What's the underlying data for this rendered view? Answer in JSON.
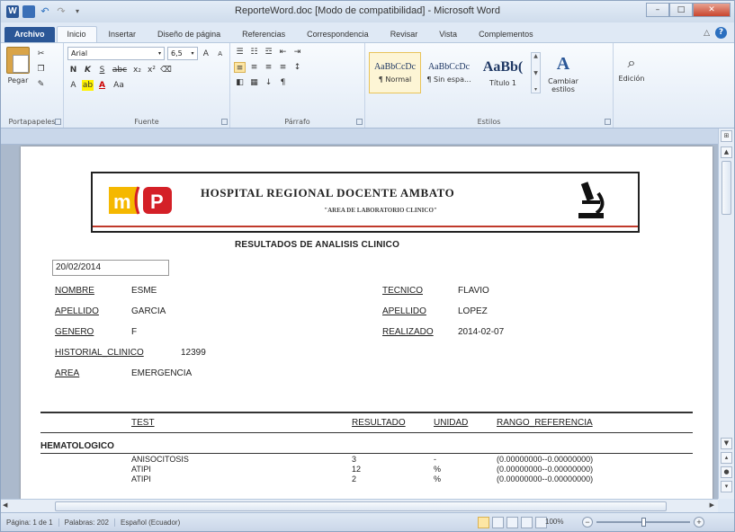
{
  "window": {
    "title": "ReporteWord.doc [Modo de compatibilidad] - Microsoft Word",
    "word_logo": "W",
    "min": "–",
    "max": "□",
    "close": "✕"
  },
  "tabs": [
    "Archivo",
    "Inicio",
    "Insertar",
    "Diseño de página",
    "Referencias",
    "Correspondencia",
    "Revisar",
    "Vista",
    "Complementos"
  ],
  "ribbon": {
    "clipboard": {
      "paste": "Pegar",
      "label": "Portapapeles"
    },
    "font": {
      "name": "Arial",
      "size": "6,5",
      "label": "Fuente",
      "b": "N",
      "i": "K",
      "u": "S",
      "strike": "abc",
      "sub": "x₂",
      "sup": "x²",
      "grow": "A",
      "shrink": "A",
      "case": "Aa"
    },
    "paragraph": {
      "label": "Párrafo",
      "pilcrow": "¶",
      "sort": "↓"
    },
    "styles": {
      "label": "Estilos",
      "items": [
        {
          "sample": "AaBbCcDc",
          "name": "¶ Normal"
        },
        {
          "sample": "AaBbCcDc",
          "name": "¶ Sin espa..."
        },
        {
          "sample": "AaBb(",
          "name": "Título 1"
        }
      ],
      "change": "Cambiar estilos"
    },
    "edit": {
      "label": "Edición"
    }
  },
  "document": {
    "hospital": "HOSPITAL REGIONAL DOCENTE AMBATO",
    "area": "\"AREA DE LABORATORIO CLINICO\"",
    "title": "RESULTADOS DE ANALISIS CLINICO",
    "date": "20/02/2014",
    "left_fields": [
      {
        "label": "NOMBRE",
        "value": "ESME"
      },
      {
        "label": "APELLIDO",
        "value": "GARCIA"
      },
      {
        "label": "GENERO",
        "value": "F"
      }
    ],
    "historial": {
      "label": "HISTORIAL_CLINICO",
      "value": "12399"
    },
    "area_field": {
      "label": "AREA",
      "value": "EMERGENCIA"
    },
    "right_fields": [
      {
        "label": "TECNICO",
        "value": "FLAVIO"
      },
      {
        "label": "APELLIDO",
        "value": "LOPEZ"
      },
      {
        "label": "REALIZADO",
        "value": "2014-02-07"
      }
    ],
    "columns": {
      "test": "TEST",
      "resultado": "RESULTADO",
      "unidad": "UNIDAD",
      "rango": "RANGO_REFERENCIA"
    },
    "section": "HEMATOLOGICO",
    "rows": [
      {
        "test": "ANISOCITOSIS",
        "resultado": "3",
        "unidad": "-",
        "rango": "(0.00000000--0.00000000)"
      },
      {
        "test": "ATIPI",
        "resultado": "12",
        "unidad": "%",
        "rango": "(0.00000000--0.00000000)"
      },
      {
        "test": "ATIPI",
        "resultado": "2",
        "unidad": "%",
        "rango": "(0.00000000--0.00000000)"
      }
    ]
  },
  "status": {
    "page": "Página: 1 de 1",
    "words": "Palabras: 202",
    "language": "Español (Ecuador)",
    "zoom": "100%",
    "zoom_minus": "−",
    "zoom_plus": "+"
  },
  "colors": {
    "accent": "#2b5797",
    "header_rule": "#c0392b"
  }
}
